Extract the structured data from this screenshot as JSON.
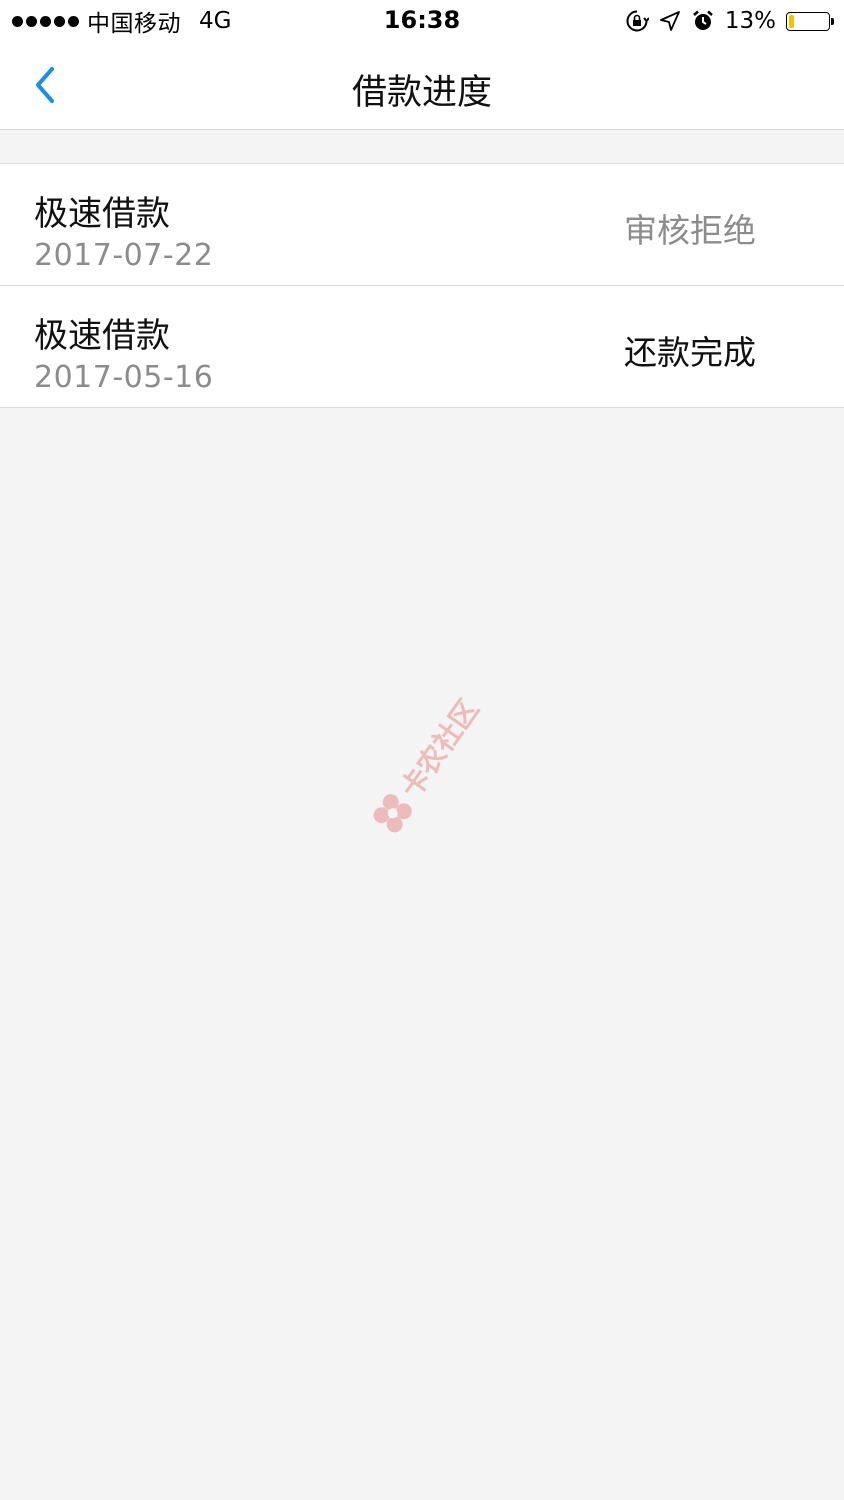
{
  "status_bar": {
    "carrier": "中国移动",
    "network": "4G",
    "time": "16:38",
    "battery_percent": "13%",
    "battery_level": 0.13,
    "battery_color": "#f5c400",
    "icons": [
      "orientation-lock-icon",
      "location-arrow-icon",
      "alarm-icon",
      "battery-icon"
    ]
  },
  "nav": {
    "title": "借款进度",
    "back_icon": "chevron-left-icon",
    "accent_color": "#1a8fe3"
  },
  "loans": [
    {
      "name": "极速借款",
      "date": "2017-07-22",
      "status": "审核拒绝",
      "status_color": "#8c8c8c"
    },
    {
      "name": "极速借款",
      "date": "2017-05-16",
      "status": "还款完成",
      "status_color": "#111111"
    }
  ],
  "watermark": {
    "text": "卡农社区",
    "color": "#d9302c"
  }
}
